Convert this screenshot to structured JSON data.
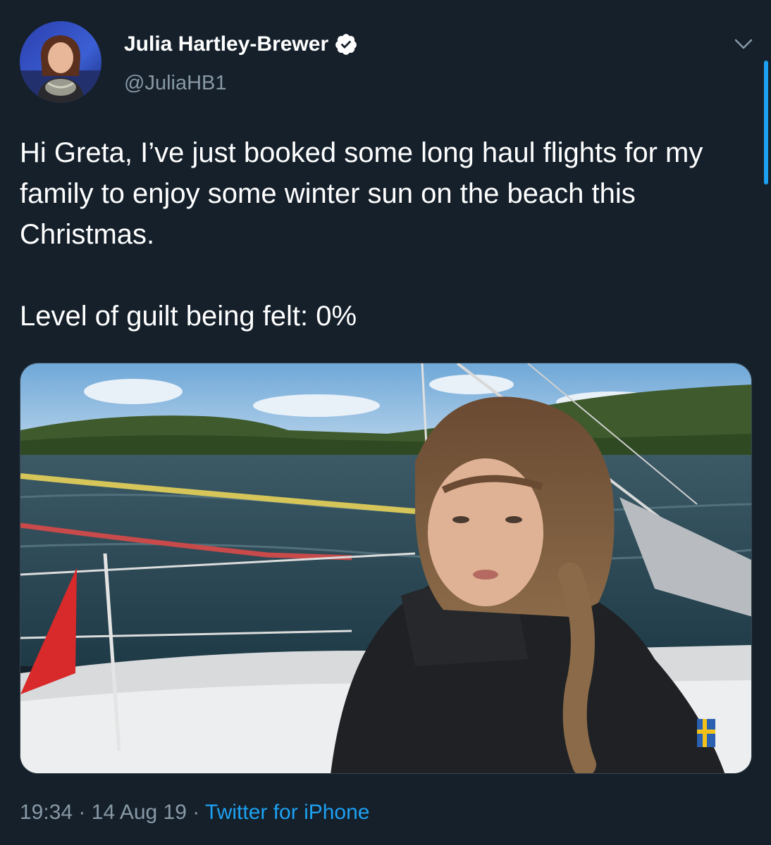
{
  "author": {
    "display_name": "Julia Hartley-Brewer",
    "handle": "@JuliaHB1",
    "verified": true,
    "avatar_icon": "profile-photo"
  },
  "tweet": {
    "lines": [
      "Hi Greta, I’ve just booked some long haul flights for my family to enjoy some winter sun on the beach this Christmas.",
      "Level of guilt being felt: 0%"
    ]
  },
  "meta": {
    "time": "19:34",
    "separator": "·",
    "date": "14 Aug 19",
    "source": "Twitter for iPhone"
  },
  "colors": {
    "background": "#15202b",
    "text": "#ffffff",
    "secondary_text": "#8899a6",
    "accent": "#1da1f2"
  }
}
